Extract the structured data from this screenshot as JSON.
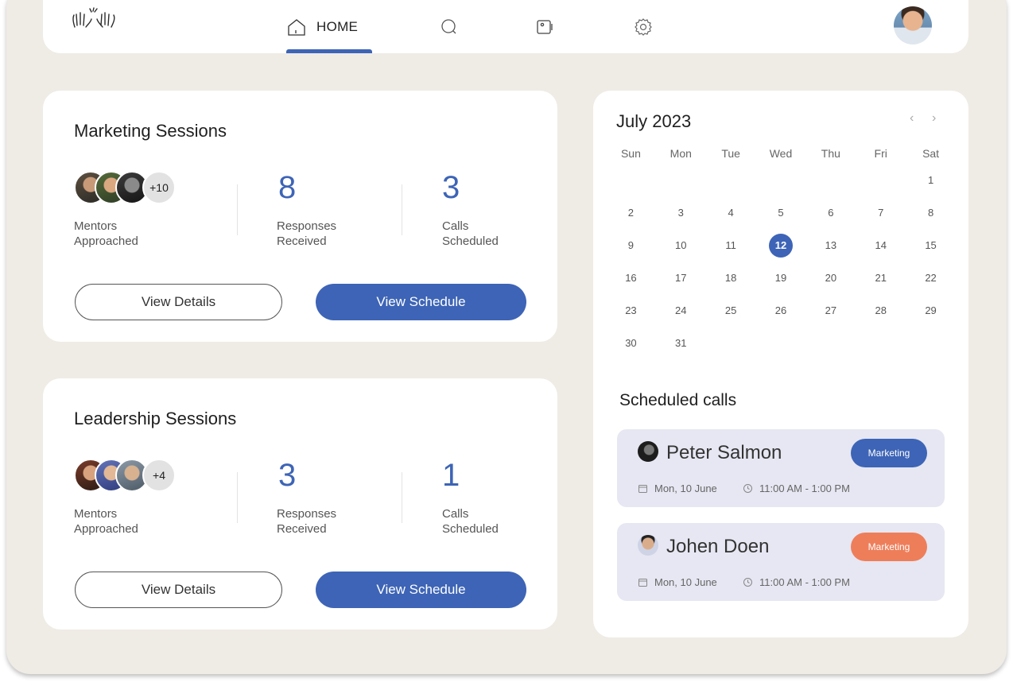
{
  "nav": {
    "home_label": "HOME"
  },
  "marketing": {
    "title": "Marketing Sessions",
    "avatars_more": "+10",
    "mentors_label_1": "Mentors",
    "mentors_label_2": "Approached",
    "responses_value": "8",
    "responses_label_1": "Responses",
    "responses_label_2": "Received",
    "calls_value": "3",
    "calls_label_1": "Calls",
    "calls_label_2": "Scheduled",
    "details_button": "View Details",
    "schedule_button": "View Schedule"
  },
  "leadership": {
    "title": "Leadership Sessions",
    "avatars_more": "+4",
    "mentors_label_1": "Mentors",
    "mentors_label_2": "Approached",
    "responses_value": "3",
    "responses_label_1": "Responses",
    "responses_label_2": "Received",
    "calls_value": "1",
    "calls_label_1": "Calls",
    "calls_label_2": "Scheduled",
    "details_button": "View Details",
    "schedule_button": "View Schedule"
  },
  "calendar": {
    "month_label": "July 2023",
    "prev": "‹",
    "next": "›",
    "weekdays": [
      "Sun",
      "Mon",
      "Tue",
      "Wed",
      "Thu",
      "Fri",
      "Sat"
    ],
    "weeks": [
      [
        "",
        "",
        "",
        "",
        "",
        "",
        "1"
      ],
      [
        "2",
        "3",
        "4",
        "5",
        "6",
        "7",
        "8"
      ],
      [
        "9",
        "10",
        "11",
        "12",
        "13",
        "14",
        "15"
      ],
      [
        "16",
        "17",
        "18",
        "19",
        "20",
        "21",
        "22"
      ],
      [
        "23",
        "24",
        "25",
        "26",
        "27",
        "28",
        "29"
      ],
      [
        "30",
        "31",
        "",
        "",
        "",
        "",
        ""
      ]
    ],
    "selected_day": "12"
  },
  "scheduled": {
    "title": "Scheduled calls",
    "calls": [
      {
        "name": "Peter Salmon",
        "tag": "Marketing",
        "tag_color": "#3d64b6",
        "date": "Mon, 10 June",
        "time": "11:00 AM - 1:00 PM"
      },
      {
        "name": "Johen Doen",
        "tag": "Marketing",
        "tag_color": "#ee7e5a",
        "date": "Mon, 10 June",
        "time": "11:00 AM - 1:00 PM"
      }
    ]
  },
  "colors": {
    "accent": "#3d64b6",
    "orange": "#ee7e5a",
    "background": "#efebe5",
    "call_card": "#e6e7f2"
  },
  "icons": {
    "logo": "high-five-hands-icon",
    "home": "home-icon",
    "search": "search-icon",
    "video": "video-icon",
    "settings": "gear-icon",
    "calendar": "calendar-icon",
    "clock": "clock-icon"
  }
}
